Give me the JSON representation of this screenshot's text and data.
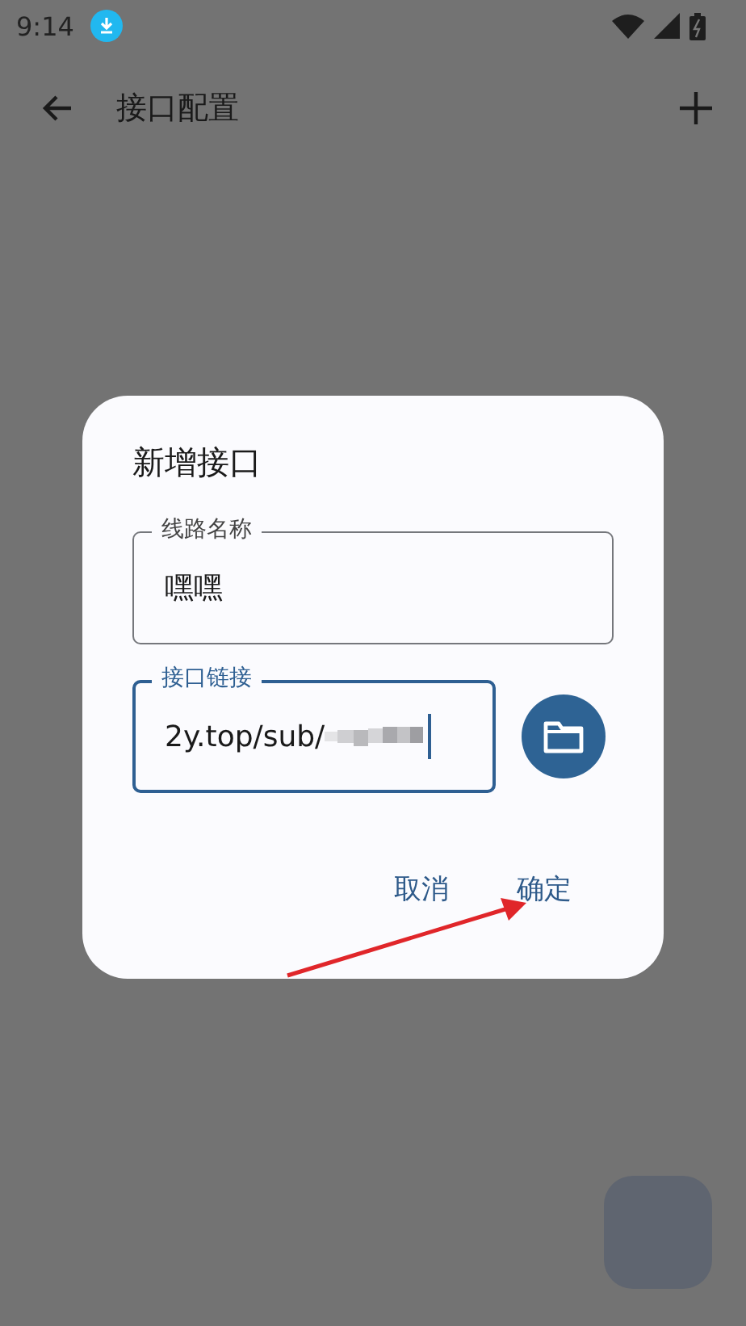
{
  "status_bar": {
    "time": "9:14"
  },
  "app_bar": {
    "title": "接口配置"
  },
  "dialog": {
    "title": "新增接口",
    "fields": [
      {
        "label": "线路名称",
        "value": "嘿嘿",
        "focused": false,
        "redacted_tail": false
      },
      {
        "label": "接口链接",
        "value": "2y.top/sub/",
        "focused": true,
        "redacted_tail": true
      }
    ],
    "buttons": [
      {
        "label": "取消"
      },
      {
        "label": "确定"
      }
    ]
  },
  "annotation": {
    "kind": "arrow"
  }
}
